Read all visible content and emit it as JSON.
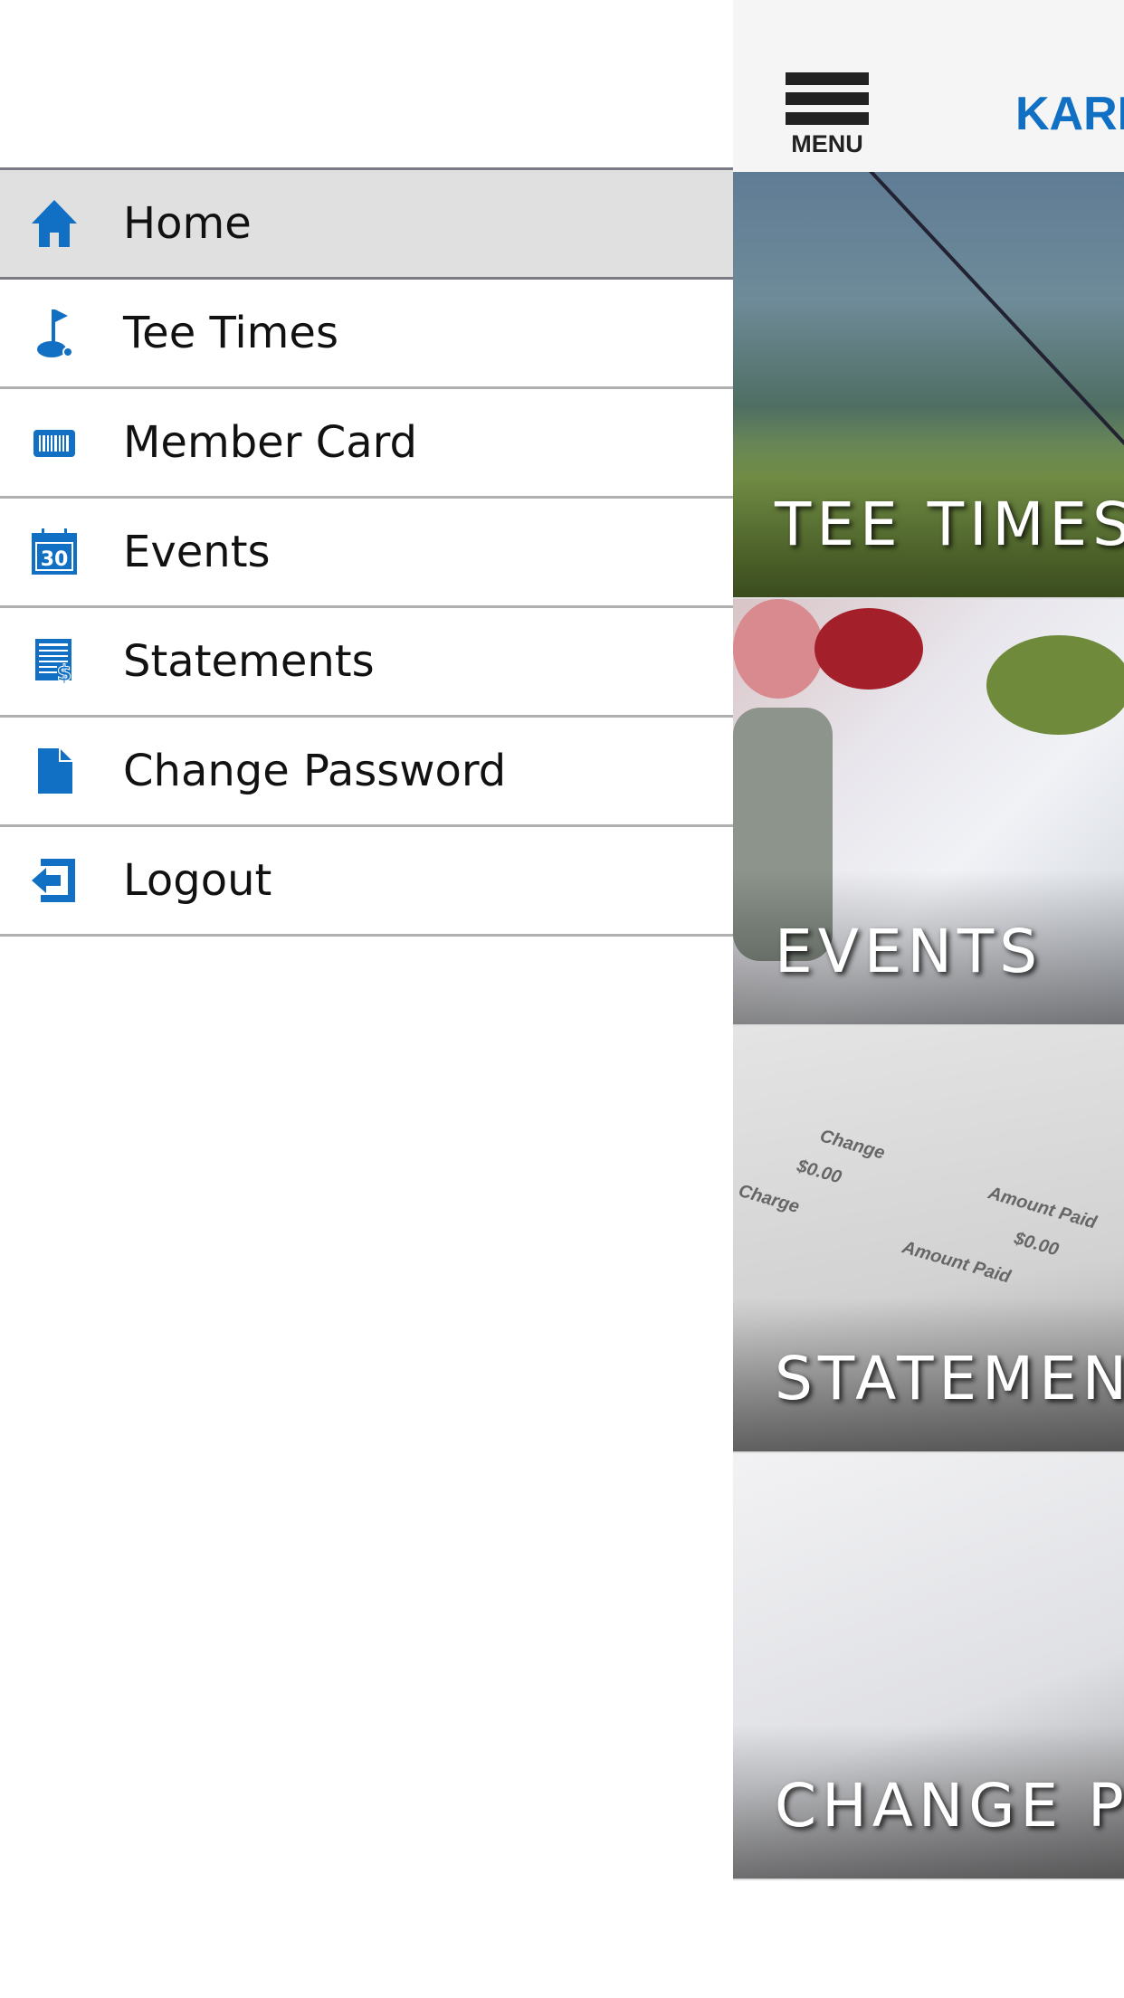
{
  "header": {
    "menu_label": "MENU",
    "title": "KARI"
  },
  "drawer": {
    "items": [
      {
        "label": "Home",
        "icon": "home-icon",
        "active": true
      },
      {
        "label": "Tee Times",
        "icon": "golf-flag-icon"
      },
      {
        "label": "Member Card",
        "icon": "barcode-card-icon"
      },
      {
        "label": "Events",
        "icon": "calendar-icon",
        "icon_text": "30"
      },
      {
        "label": "Statements",
        "icon": "statement-dollar-icon"
      },
      {
        "label": "Change Password",
        "icon": "document-icon"
      },
      {
        "label": "Logout",
        "icon": "logout-icon"
      }
    ]
  },
  "tiles": [
    {
      "label": "TEE TIMES"
    },
    {
      "label": "EVENTS"
    },
    {
      "label": "STATEMENTS"
    },
    {
      "label": "CHANGE PASSWORD"
    }
  ],
  "statement_photo_text": [
    "Change",
    "$0.00",
    "Amount Paid",
    "Charge",
    "$0.00",
    "Amount Paid"
  ],
  "colors": {
    "accent": "#1270c4",
    "active_row": "#e0e0e0",
    "divider": "#b0b0b0"
  }
}
